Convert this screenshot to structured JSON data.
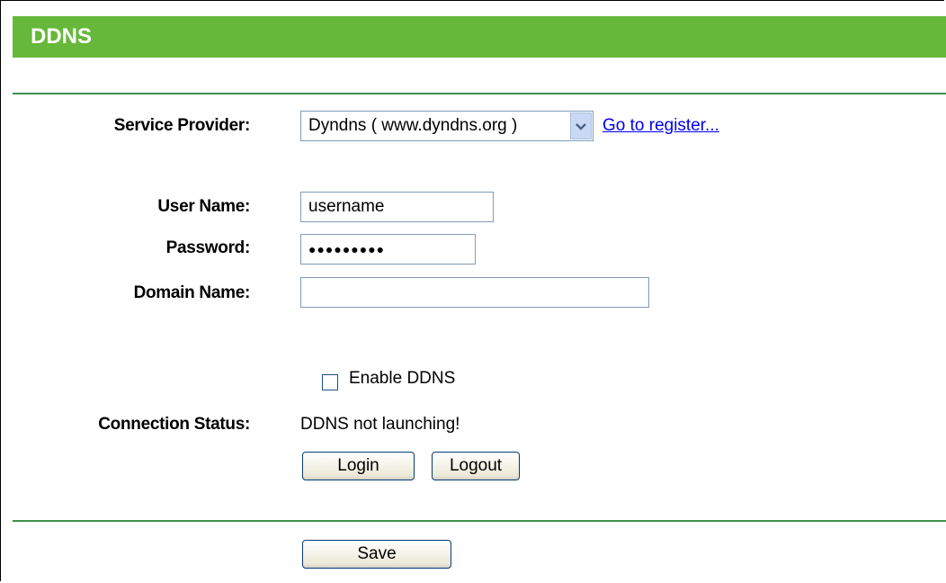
{
  "header": {
    "title": "DDNS"
  },
  "form": {
    "service_provider_label": "Service Provider:",
    "service_provider_value": "Dyndns ( www.dyndns.org )",
    "register_link": "Go to register...",
    "username_label": "User Name:",
    "username_value": "username",
    "password_label": "Password:",
    "password_value": "●●●●●●●●●",
    "domain_label": "Domain Name:",
    "domain_value": "",
    "enable_label": "Enable DDNS",
    "enable_checked": false,
    "status_label": "Connection Status:",
    "status_value": "DDNS not launching!",
    "login_label": "Login",
    "logout_label": "Logout",
    "save_label": "Save"
  },
  "colors": {
    "header_bg": "#66b83a",
    "rule": "#3d8f4f",
    "link": "#0000ee"
  },
  "icons": {
    "select_arrow": "chevron-down-icon"
  }
}
